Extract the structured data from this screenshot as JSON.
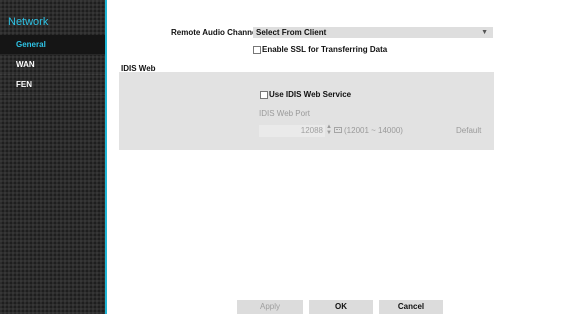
{
  "sidebar": {
    "title": "Network",
    "items": [
      {
        "label": "General"
      },
      {
        "label": "WAN"
      },
      {
        "label": "FEN"
      }
    ]
  },
  "general": {
    "remote_audio_label": "Remote Audio Channel",
    "remote_audio_value": "Select From Client",
    "ssl_label": "Enable SSL for Transferring Data",
    "idis_web_section": "IDIS Web",
    "use_idis_label": "Use IDIS Web Service",
    "port_label": "IDIS Web Port",
    "port_value": "12088",
    "port_range": "(12001 ~ 14000)",
    "default_label": "Default"
  },
  "buttons": {
    "apply": "Apply",
    "ok": "OK",
    "cancel": "Cancel"
  },
  "colors": {
    "accent": "#1fb7d6",
    "sidebar_bg": "#2c2c2c",
    "panel_bg": "#e2e2e2"
  }
}
